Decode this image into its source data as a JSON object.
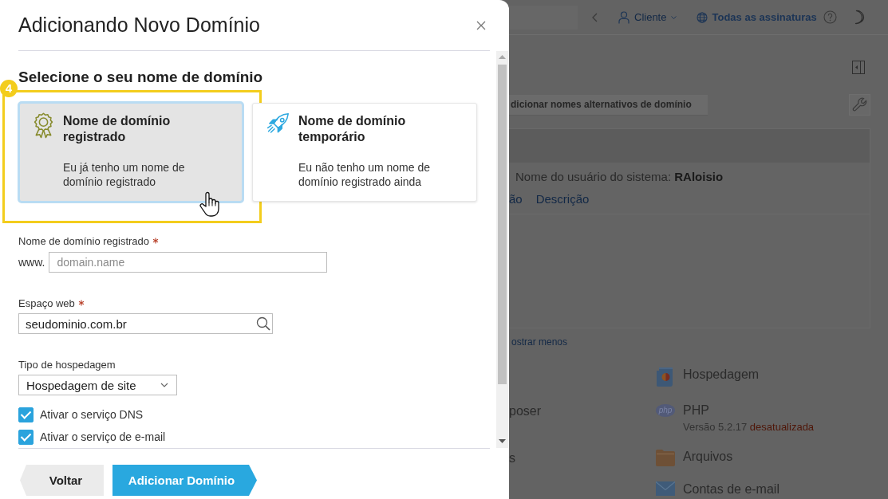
{
  "dialog": {
    "title": "Adicionando Novo Domínio",
    "section_title": "Selecione o seu nome de domínio",
    "options": [
      {
        "kind": "registered",
        "title": "Nome de domínio registrado",
        "description": "Eu já tenho um nome de domínio registrado",
        "selected": true,
        "annotation": "4"
      },
      {
        "kind": "temporary",
        "title": "Nome de domínio temporário",
        "description": "Eu não tenho um nome de domínio registrado ainda",
        "selected": false
      }
    ],
    "fields": [
      {
        "kind": "text",
        "label": "Nome de domínio registrado",
        "required": true,
        "prefix": "www.",
        "placeholder": "domain.name"
      },
      {
        "kind": "search",
        "label": "Espaço web",
        "required": true,
        "value": "seudominio.com.br"
      },
      {
        "kind": "select",
        "label": "Tipo de hospedagem",
        "required": false,
        "value": "Hospedagem de site"
      }
    ],
    "checkboxes": [
      {
        "label": "Ativar o serviço DNS",
        "checked": true
      },
      {
        "label": "Ativar o serviço de e-mail",
        "checked": true
      }
    ],
    "buttons": [
      {
        "kind": "back",
        "label": "Voltar"
      },
      {
        "kind": "primary",
        "label": "Adicionar Domínio"
      }
    ]
  },
  "background": {
    "header": {
      "user_menu": "Cliente",
      "subscriptions_link": "Todas as assinaturas"
    },
    "alias_button": "dicionar nomes alternativos de domínio",
    "system_user": "Nome do usuário do sistema: **RAloisio**",
    "links": [
      "ão",
      "Descrição"
    ],
    "show_less_link": "ostrar menos",
    "left_items": [
      "poser",
      "s"
    ],
    "tools": [
      {
        "kind": "hosting",
        "title": "Hospedagem"
      },
      {
        "kind": "php",
        "title": "PHP",
        "logo_text": "php",
        "version": "Versão 5.2.17",
        "status": "desatualizada"
      },
      {
        "kind": "files",
        "title": "Arquivos"
      },
      {
        "kind": "mail",
        "title": "Contas de e-mail"
      }
    ]
  }
}
